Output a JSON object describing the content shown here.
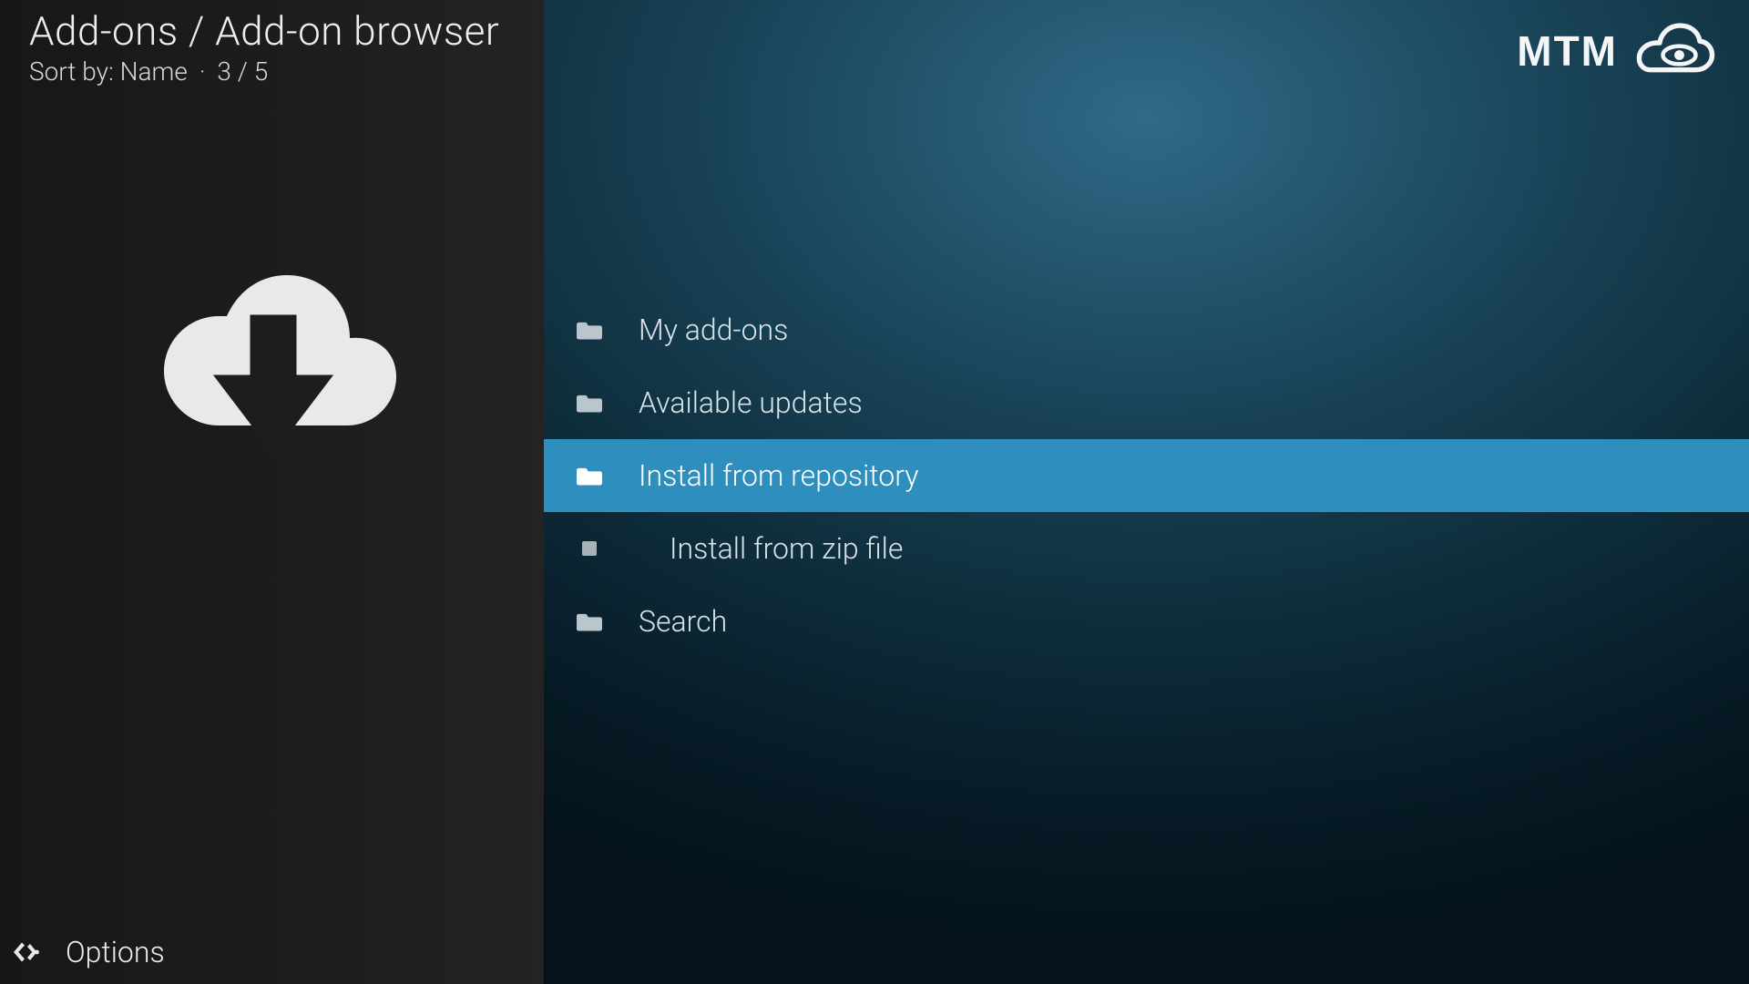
{
  "header": {
    "breadcrumb": "Add-ons / Add-on browser",
    "sort_label": "Sort by:",
    "sort_value": "Name",
    "position": "3 / 5"
  },
  "sidebar": {
    "options_label": "Options"
  },
  "watermark": {
    "text": "MTM"
  },
  "list": {
    "items": [
      {
        "label": "My add-ons",
        "icon": "folder",
        "selected": false
      },
      {
        "label": "Available updates",
        "icon": "folder",
        "selected": false
      },
      {
        "label": "Install from repository",
        "icon": "folder",
        "selected": true
      },
      {
        "label": "Install from zip file",
        "icon": "file",
        "selected": false
      },
      {
        "label": "Search",
        "icon": "folder",
        "selected": false
      }
    ]
  }
}
